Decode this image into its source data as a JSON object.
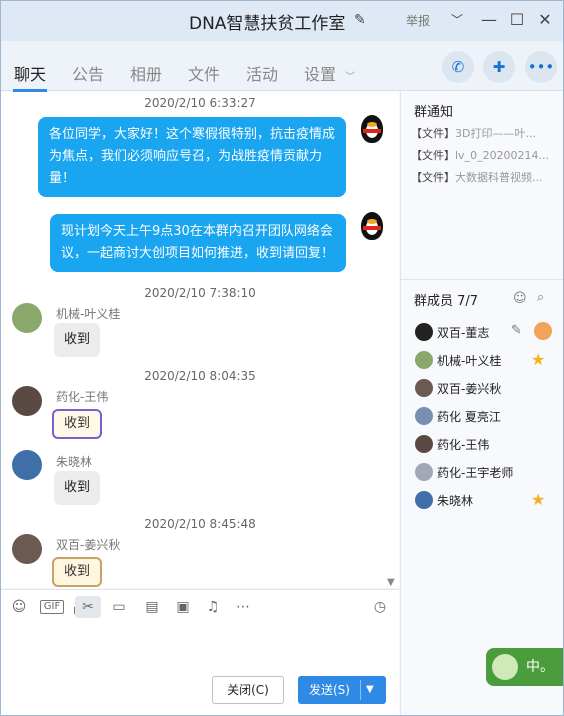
{
  "window": {
    "title": "DNA智慧扶贫工作室",
    "report": "举报"
  },
  "tabs": [
    {
      "label": "聊天"
    },
    {
      "label": "公告"
    },
    {
      "label": "相册"
    },
    {
      "label": "文件"
    },
    {
      "label": "活动"
    },
    {
      "label": "设置"
    }
  ],
  "chat": {
    "messages": [
      {
        "time": "2020/2/10 6:33:27",
        "text": "各位同学，大家好！这个寒假很特别，抗击疫情成为焦点，我们必须响应号召，为战胜疫情贡献力量！"
      },
      {
        "text": "现计划今天上午9点30在本群内召开团队网络会议，一起商讨大创项目如何推进，收到请回复！"
      },
      {
        "time": "2020/2/10 7:38:10",
        "sender": "机械-叶义桂",
        "text": "收到"
      },
      {
        "time": "2020/2/10 8:04:35",
        "sender": "药化-王伟",
        "text": "收到"
      },
      {
        "sender": "朱晓林",
        "text": "收到"
      },
      {
        "time": "2020/2/10 8:45:48",
        "sender": "双百-姜兴秋",
        "text": "收到"
      }
    ]
  },
  "toolbar": {
    "gif_label": "GIF",
    "icons": [
      "emoji-icon",
      "gif-icon",
      "screenshot-icon",
      "folder-icon",
      "image-file-icon",
      "picture-icon",
      "bell-icon",
      "more-icon",
      "history-icon"
    ]
  },
  "compose": {
    "close_label": "关闭(C)",
    "send_label": "发送(S)"
  },
  "group_notice": {
    "title": "群通知",
    "items": [
      {
        "tag": "【文件】",
        "name": "3D打印——叶..."
      },
      {
        "tag": "【文件】",
        "name": "lv_0_20200214..."
      },
      {
        "tag": "【文件】",
        "name": "大数据科普视频..."
      }
    ]
  },
  "members": {
    "title": "群成员 7/7",
    "list": [
      {
        "name": "双百-董志"
      },
      {
        "name": "机械-叶义桂"
      },
      {
        "name": "双百-姜兴秋"
      },
      {
        "name": "药化 夏亮江"
      },
      {
        "name": "药化-王伟"
      },
      {
        "name": "药化-王宇老师"
      },
      {
        "name": "朱晓林"
      }
    ]
  },
  "ime": {
    "label": "中。"
  },
  "colors": {
    "accent": "#2f8ae5",
    "bubble": "#1aa5f0",
    "star": "#f5b21a"
  }
}
